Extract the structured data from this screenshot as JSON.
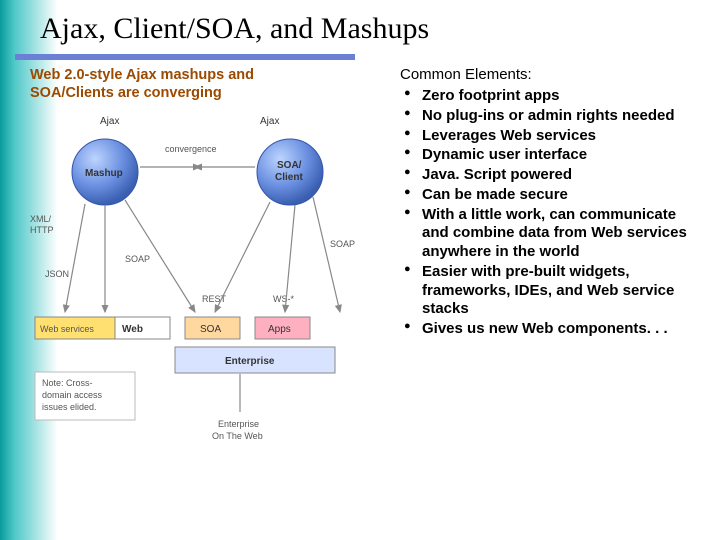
{
  "title": "Ajax, Client/SOA, and Mashups",
  "diagram": {
    "heading_line1": "Web 2.0-style Ajax mashups and",
    "heading_line2": "SOA/Clients are converging",
    "node_mashup": "Mashup",
    "node_soa_client_l1": "SOA/",
    "node_soa_client_l2": "Client",
    "ajax_left": "Ajax",
    "ajax_right": "Ajax",
    "convergence": "convergence",
    "xml_http_l1": "XML/",
    "xml_http_l2": "HTTP",
    "json": "JSON",
    "soap_left": "SOAP",
    "soap_right": "SOAP",
    "rest": "REST",
    "ws_star": "WS-*",
    "box_webservices": "Web services",
    "box_web": "Web",
    "box_soa": "SOA",
    "box_apps": "Apps",
    "box_enterprise": "Enterprise",
    "note_l1": "Note: Cross-",
    "note_l2": "domain access",
    "note_l3": "issues elided.",
    "footer_l1": "Enterprise",
    "footer_l2": "On The Web"
  },
  "right": {
    "heading": "Common Elements:",
    "items": [
      "Zero footprint apps",
      "No plug-ins or admin rights needed",
      "Leverages Web services",
      "Dynamic user interface",
      "Java. Script powered",
      "Can be made secure",
      "With a little work, can communicate and combine data from Web services anywhere in the world",
      "Easier with pre-built widgets, frameworks, IDEs, and Web service stacks",
      "Gives us new Web components. . ."
    ]
  }
}
